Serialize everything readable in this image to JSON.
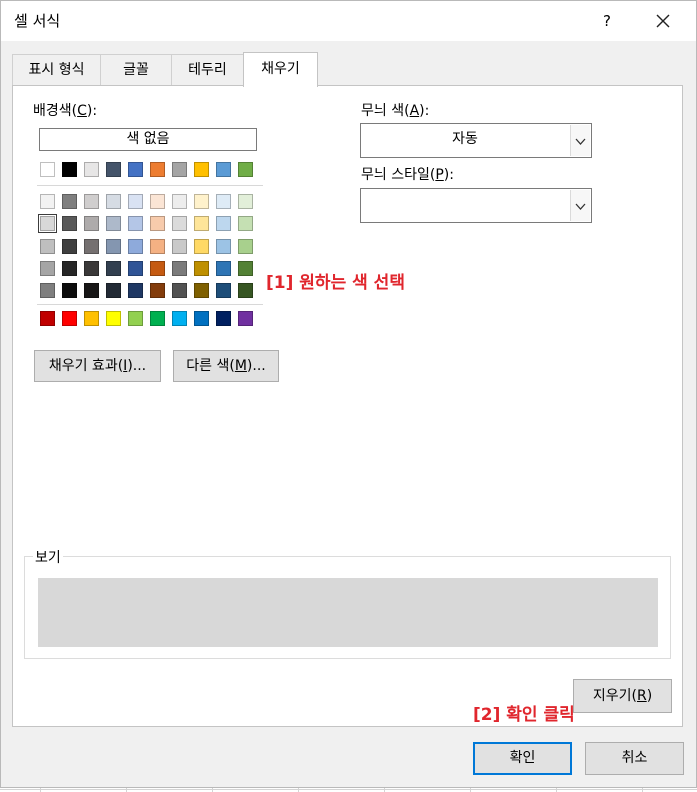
{
  "dialog": {
    "title": "셀 서식",
    "help": "?"
  },
  "tabs": [
    {
      "label": "표시 형식"
    },
    {
      "label": "글꼴"
    },
    {
      "label": "테두리"
    },
    {
      "label": "채우기"
    }
  ],
  "fill": {
    "background_label": "배경색",
    "background_key": "C",
    "no_color_label": "색 없음",
    "theme_top": [
      "#ffffff",
      "#000000",
      "#e7e6e6",
      "#44546a",
      "#4472c4",
      "#ed7d31",
      "#a5a5a5",
      "#ffc000",
      "#5b9bd5",
      "#70ad47"
    ],
    "theme_tints": [
      [
        "#f2f2f2",
        "#7f7f7f",
        "#d0cece",
        "#d6dce4",
        "#d9e2f3",
        "#fbe5d5",
        "#ededed",
        "#fff2cc",
        "#deebf6",
        "#e2efd9"
      ],
      [
        "#d8d8d8",
        "#595959",
        "#aeabab",
        "#adb9ca",
        "#b4c6e7",
        "#f7cbac",
        "#dbdbdb",
        "#fee599",
        "#bdd7ee",
        "#c5e0b3"
      ],
      [
        "#bfbfbf",
        "#3f3f3f",
        "#757070",
        "#8496b0",
        "#8eaadb",
        "#f4b183",
        "#c9c9c9",
        "#ffd965",
        "#9cc3e5",
        "#a8d08d"
      ],
      [
        "#a5a5a5",
        "#262626",
        "#3a3838",
        "#323f4f",
        "#2f5496",
        "#c55a11",
        "#7b7b7b",
        "#bf9000",
        "#2e75b5",
        "#538135"
      ],
      [
        "#7f7f7f",
        "#0c0c0c",
        "#171616",
        "#222a35",
        "#1f3864",
        "#833c0b",
        "#525252",
        "#7f6000",
        "#1e4e79",
        "#375623"
      ]
    ],
    "standard": [
      "#c00000",
      "#ff0000",
      "#ffc000",
      "#ffff00",
      "#92d050",
      "#00b050",
      "#00b0f0",
      "#0070c0",
      "#002060",
      "#7030a0"
    ],
    "selected_color": "#d8d8d8",
    "fill_effects_label": "채우기 효과",
    "fill_effects_key": "I",
    "more_colors_label": "다른 색",
    "more_colors_key": "M",
    "ellipsis": "..."
  },
  "pattern": {
    "color_label": "무늬 색",
    "color_key": "A",
    "color_value": "자동",
    "style_label": "무늬 스타일",
    "style_key": "P",
    "style_value": ""
  },
  "annotations": {
    "step1": "[1] 원하는 색 선택",
    "step2": "[2] 확인 클릭"
  },
  "preview": {
    "label": "보기",
    "fill_color": "#d8d8d8"
  },
  "buttons": {
    "clear_label": "지우기",
    "clear_key": "R",
    "ok_label": "확인",
    "cancel_label": "취소"
  },
  "colors": {
    "annotation_red": "#e0262d",
    "focus_blue": "#0078d7"
  }
}
